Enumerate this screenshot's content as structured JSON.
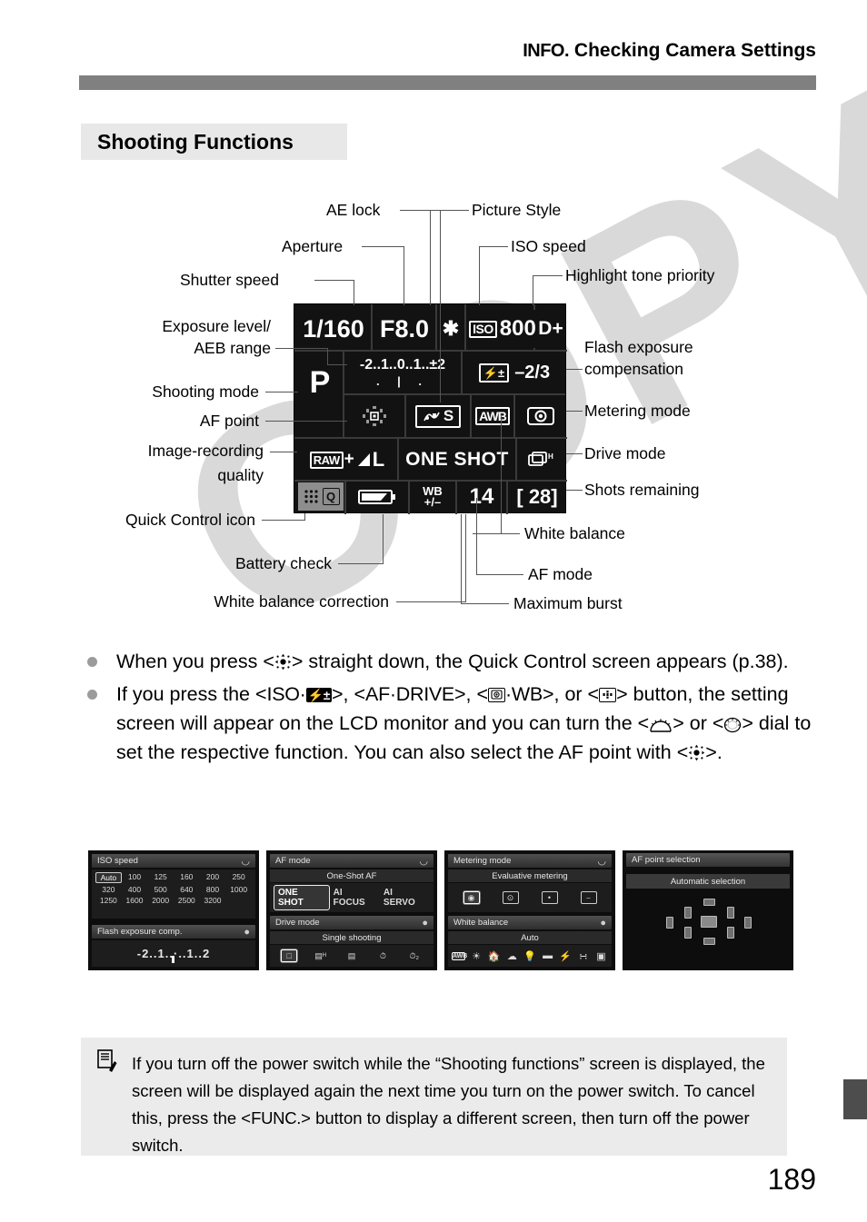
{
  "header": {
    "info_mark": "INFO.",
    "title": "Checking Camera Settings"
  },
  "section": {
    "heading": "Shooting Functions"
  },
  "page_number": "189",
  "watermark": {
    "text": "COPY"
  },
  "lcd": {
    "shutter_speed": "1/160",
    "aperture": "F8.0",
    "ae_lock": "✱",
    "iso_prefix": "ISO",
    "iso_value": "800",
    "highlight_tone_priority": "D+",
    "shooting_mode": "P",
    "exposure_scale_top": "-2..1..0..1..±2",
    "exposure_scale_bottom": ". | .",
    "flash_exp_icon": "⚡±",
    "flash_exp_value": "–2/3",
    "af_point_icon": "af-point-icon",
    "picture_style": "S",
    "white_balance": "AWB",
    "metering_icon": "evaluative-metering-icon",
    "quality_raw": "RAW",
    "quality_plus": "+",
    "quality_jpeg": "L",
    "af_mode": "ONE SHOT",
    "drive_icon": "high-speed-continuous-icon",
    "quick_control": "Q",
    "battery_icon": "battery-full-icon",
    "wb_corr_line1": "WB",
    "wb_corr_line2": "+/–",
    "max_burst": "14",
    "shots_remaining": "[ 28]"
  },
  "callouts": {
    "ae_lock": "AE lock",
    "picture_style": "Picture Style",
    "aperture": "Aperture",
    "iso_speed": "ISO speed",
    "shutter_speed": "Shutter speed",
    "highlight_tone_priority": "Highlight tone priority",
    "exposure_level_1": "Exposure level/",
    "exposure_level_2": "AEB range",
    "flash_exp_comp_1": "Flash exposure",
    "flash_exp_comp_2": "compensation",
    "shooting_mode": "Shooting mode",
    "af_point": "AF point",
    "metering_mode": "Metering mode",
    "image_quality_1": "Image-recording",
    "image_quality_2": "quality",
    "drive_mode": "Drive mode",
    "shots_remaining": "Shots remaining",
    "quick_control_icon": "Quick Control icon",
    "white_balance": "White balance",
    "battery_check": "Battery check",
    "af_mode": "AF mode",
    "wb_correction": "White balance correction",
    "maximum_burst": "Maximum burst"
  },
  "bullets": {
    "b1_part1": "When you press <",
    "b1_part2": "> straight down, the Quick Control screen appears (p.38).",
    "b2_part1": "If you press the <",
    "b2_iso": "ISO",
    "b2_dot1": "·",
    "b2_flash": "⚡±",
    "b2_part2": ">, <",
    "b2_afdrive": "AF·DRIVE",
    "b2_part3": ">, <",
    "b2_dot2": "·WB",
    "b2_part4": ">, or <",
    "b2_part5": "> button, the setting screen will appear on the LCD monitor and you can turn the <",
    "b2_part6": "> or <",
    "b2_part7": "> dial to set the respective function. You can also select the AF point with <",
    "b2_part8": ">."
  },
  "thumbnails": [
    {
      "name": "iso-speed-screen",
      "title": "ISO speed",
      "dial_icon": "main-dial-icon",
      "iso_values": [
        "Auto",
        "100",
        "125",
        "160",
        "200",
        "250",
        "320",
        "400",
        "500",
        "640",
        "800",
        "1000",
        "1250",
        "1600",
        "2000",
        "2500",
        "3200"
      ],
      "selected_iso": "Auto",
      "sub_title": "Flash exposure comp.",
      "sub_dial_icon": "quick-control-dial-icon",
      "scale": "-2..1..·..1..2"
    },
    {
      "name": "af-mode-screen",
      "title": "AF mode",
      "dial_icon": "main-dial-icon",
      "current": "One-Shot AF",
      "options": [
        "ONE SHOT",
        "AI FOCUS",
        "AI SERVO"
      ],
      "selected_option": "ONE SHOT",
      "sub_title": "Drive mode",
      "sub_dial_icon": "quick-control-dial-icon",
      "sub_current": "Single shooting",
      "sub_icons": [
        "single-shooting-icon",
        "high-speed-continuous-icon",
        "low-speed-continuous-icon",
        "self-timer-icon",
        "self-timer-2s-icon"
      ],
      "sub_selected_index": 0
    },
    {
      "name": "metering-mode-screen",
      "title": "Metering mode",
      "dial_icon": "main-dial-icon",
      "current": "Evaluative metering",
      "icons": [
        "evaluative-metering-icon",
        "partial-metering-icon",
        "spot-metering-icon",
        "center-weighted-metering-icon"
      ],
      "selected_index": 0,
      "sub_title": "White balance",
      "sub_dial_icon": "quick-control-dial-icon",
      "sub_current": "Auto",
      "sub_icons": [
        "awb-icon",
        "daylight-icon",
        "shade-icon",
        "cloudy-icon",
        "tungsten-icon",
        "fluorescent-icon",
        "flash-icon",
        "custom-wb-icon",
        "color-temp-icon"
      ],
      "sub_selected_index": 0
    },
    {
      "name": "af-point-selection-screen",
      "title": "AF point selection",
      "current": "Automatic selection",
      "points": 9
    }
  ],
  "note": {
    "icon": "note-pencil-icon",
    "text_1": "If you turn off the power switch while the “Shooting functions” screen is displayed, the screen will be displayed again the next time you turn on the power switch. To cancel this, press the <",
    "func_label": "FUNC.",
    "text_2": "> button to display a different screen, then turn off the power switch."
  }
}
